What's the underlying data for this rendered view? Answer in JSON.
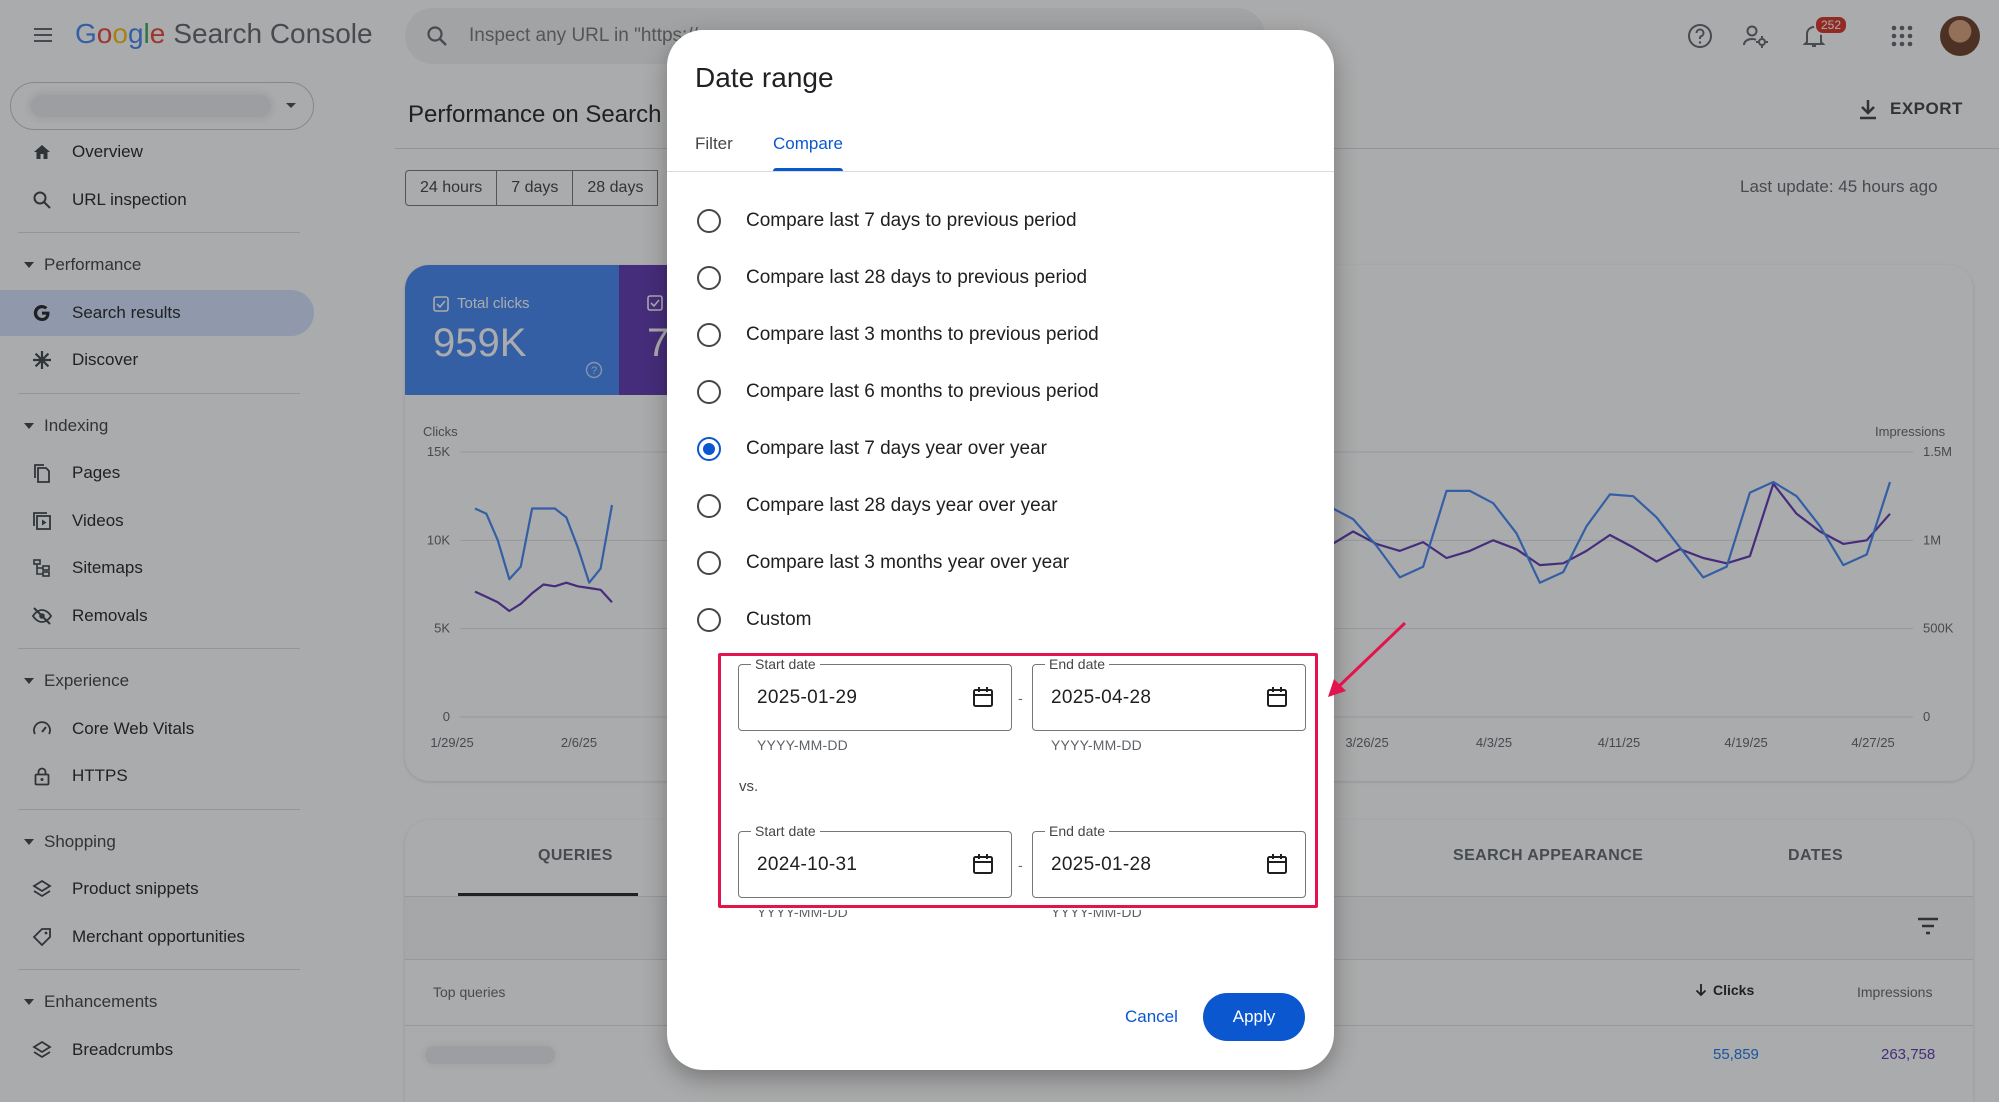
{
  "header": {
    "logo_google": "Google",
    "logo_suffix": "Search Console",
    "search_placeholder": "Inspect any URL in \"https://...",
    "notification_count": "252"
  },
  "sidebar": {
    "items": [
      {
        "label": "Overview",
        "icon": "home-icon"
      },
      {
        "label": "URL inspection",
        "icon": "search-icon"
      }
    ],
    "sections": [
      {
        "title": "Performance",
        "items": [
          {
            "label": "Search results",
            "icon": "google-g-icon",
            "active": true
          },
          {
            "label": "Discover",
            "icon": "asterisk-icon"
          }
        ]
      },
      {
        "title": "Indexing",
        "items": [
          {
            "label": "Pages",
            "icon": "pages-icon"
          },
          {
            "label": "Videos",
            "icon": "video-icon"
          },
          {
            "label": "Sitemaps",
            "icon": "sitemap-icon"
          },
          {
            "label": "Removals",
            "icon": "eye-off-icon"
          }
        ]
      },
      {
        "title": "Experience",
        "items": [
          {
            "label": "Core Web Vitals",
            "icon": "gauge-icon"
          },
          {
            "label": "HTTPS",
            "icon": "lock-icon"
          }
        ]
      },
      {
        "title": "Shopping",
        "items": [
          {
            "label": "Product snippets",
            "icon": "layers-icon"
          },
          {
            "label": "Merchant opportunities",
            "icon": "tag-icon"
          }
        ]
      },
      {
        "title": "Enhancements",
        "items": [
          {
            "label": "Breadcrumbs",
            "icon": "layers-icon"
          }
        ]
      }
    ]
  },
  "main": {
    "title": "Performance on Search",
    "export_label": "EXPORT",
    "range_chips": [
      "24 hours",
      "7 days",
      "28 days"
    ],
    "last_update": "Last update: 45 hours ago",
    "metrics": {
      "clicks_label": "Total clicks",
      "clicks_value": "959K",
      "impressions_value_partial": "7"
    },
    "table": {
      "tabs": {
        "queries": "QUERIES",
        "search_appearance": "SEARCH APPEARANCE",
        "dates": "DATES"
      },
      "col_query": "Top queries",
      "col_clicks": "Clicks",
      "col_impressions": "Impressions",
      "row_clicks": "55,859",
      "row_impressions": "263,758"
    }
  },
  "chart_data": {
    "type": "line",
    "ylabel": "Clicks",
    "y2label": "Impressions",
    "y_ticks": [
      "15K",
      "10K",
      "5K",
      "0"
    ],
    "y2_ticks": [
      "1.5M",
      "1M",
      "500K",
      "0"
    ],
    "ylim": [
      0,
      15000
    ],
    "y2lim": [
      0,
      1500000
    ],
    "x_ticks": [
      "1/29/25",
      "2/6/25",
      "3/26/25",
      "4/3/25",
      "4/11/25",
      "4/19/25",
      "4/27/25"
    ],
    "series": [
      {
        "name": "Clicks",
        "color": "#4285f4",
        "left_values": [
          11800,
          11500,
          10000,
          7800,
          8500,
          11800,
          11800,
          11800,
          11300,
          9600,
          7600,
          8400,
          12000
        ],
        "right_values": [
          13200,
          13200,
          12000,
          10200,
          7700,
          8400,
          10800,
          12200,
          11900,
          11200,
          9700,
          7900,
          8500,
          12800,
          12800,
          12100,
          10400,
          7600,
          8200,
          10800,
          12600,
          12500,
          11300,
          9600,
          7900,
          8500,
          12700,
          13300,
          12500,
          10800,
          8600,
          9200,
          13300
        ]
      },
      {
        "name": "Impressions",
        "color": "#5e35b1",
        "left_values": [
          710000,
          680000,
          650000,
          600000,
          640000,
          700000,
          750000,
          740000,
          760000,
          740000,
          730000,
          720000,
          650000
        ],
        "right_values": [
          1180000,
          1200000,
          1000000,
          850000,
          820000,
          840000,
          1100000,
          1020000,
          970000,
          1050000,
          980000,
          940000,
          990000,
          900000,
          940000,
          1000000,
          950000,
          860000,
          870000,
          940000,
          1030000,
          960000,
          880000,
          950000,
          900000,
          870000,
          910000,
          1320000,
          1150000,
          1050000,
          980000,
          1000000,
          1150000
        ]
      }
    ]
  },
  "dialog": {
    "title": "Date range",
    "tabs": {
      "filter": "Filter",
      "compare": "Compare"
    },
    "options": [
      {
        "label": "Compare last 7 days to previous period",
        "selected": false
      },
      {
        "label": "Compare last 28 days to previous period",
        "selected": false
      },
      {
        "label": "Compare last 3 months to previous period",
        "selected": false
      },
      {
        "label": "Compare last 6 months to previous period",
        "selected": false
      },
      {
        "label": "Compare last 7 days year over year",
        "selected": true
      },
      {
        "label": "Compare last 28 days year over year",
        "selected": false
      },
      {
        "label": "Compare last 3 months year over year",
        "selected": false
      },
      {
        "label": "Custom",
        "selected": false
      }
    ],
    "range1": {
      "start_label": "Start date",
      "start_value": "2025-01-29",
      "end_label": "End date",
      "end_value": "2025-04-28"
    },
    "range2": {
      "start_label": "Start date",
      "start_value": "2024-10-31",
      "end_label": "End date",
      "end_value": "2025-01-28"
    },
    "date_hint": "YYYY-MM-DD",
    "dash": "-",
    "vs_label": "vs.",
    "cancel_label": "Cancel",
    "apply_label": "Apply",
    "accent_color": "#0b57d0",
    "highlight_color": "#e2134d"
  }
}
